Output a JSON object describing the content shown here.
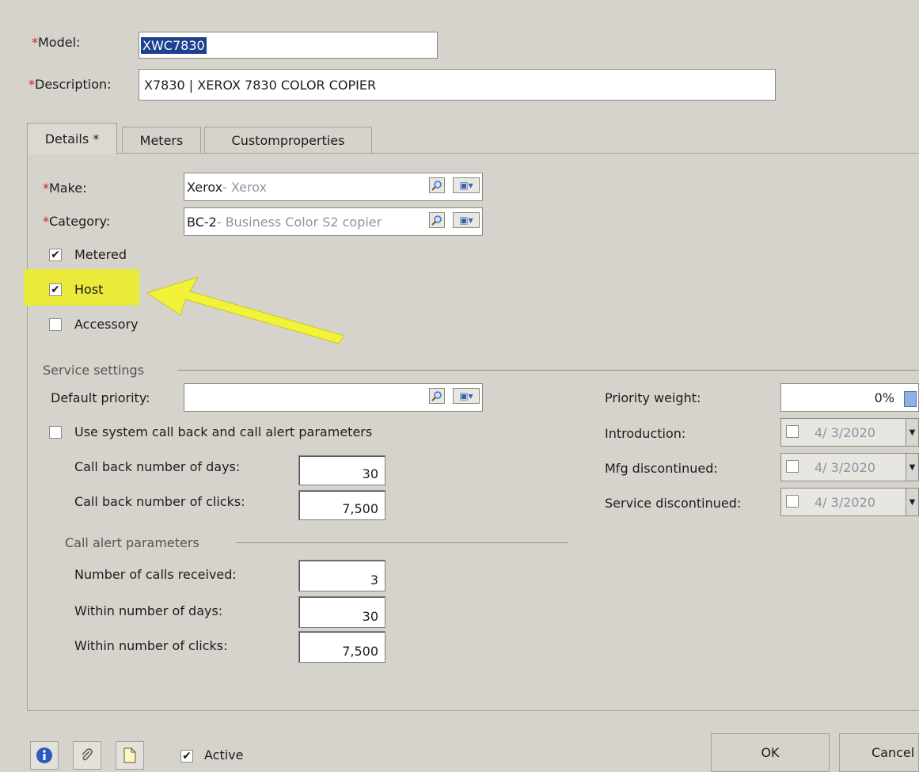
{
  "header": {
    "model_label": "Model:",
    "model_value": "XWC7830",
    "description_label": "Description:",
    "description_value": "X7830  |  XEROX 7830 COLOR COPIER"
  },
  "tabs": [
    {
      "label": "Details *"
    },
    {
      "label": "Meters"
    },
    {
      "label": "Customproperties"
    }
  ],
  "details": {
    "make_label": "Make:",
    "make_code": "Xerox",
    "make_desc": " - Xerox",
    "category_label": "Category:",
    "category_code": "BC-2",
    "category_desc": " - Business Color S2 copier",
    "metered_label": "Metered",
    "metered_checked": true,
    "host_label": "Host",
    "host_checked": true,
    "accessory_label": "Accessory",
    "accessory_checked": false
  },
  "service": {
    "group_title": "Service settings",
    "default_priority_label": "Default priority:",
    "default_priority_value": "",
    "use_system_label": "Use system call back and call alert parameters",
    "use_system_checked": false,
    "callback_days_label": "Call back number of days:",
    "callback_days_value": "30",
    "callback_clicks_label": "Call back number of clicks:",
    "callback_clicks_value": "7,500",
    "alert_group_title": "Call alert parameters",
    "calls_received_label": "Number of calls received:",
    "calls_received_value": "3",
    "within_days_label": "Within number of days:",
    "within_days_value": "30",
    "within_clicks_label": "Within number of clicks:",
    "within_clicks_value": "7,500",
    "priority_weight_label": "Priority weight:",
    "priority_weight_value": "0%",
    "introduction_label": "Introduction:",
    "introduction_value": "4/ 3/2020",
    "mfg_disc_label": "Mfg discontinued:",
    "mfg_disc_value": "4/ 3/2020",
    "service_disc_label": "Service discontinued:",
    "service_disc_value": "4/ 3/2020"
  },
  "footer": {
    "active_label": "Active",
    "active_checked": true,
    "ok_label": "OK",
    "cancel_label": "Cancel"
  },
  "colors": {
    "highlight": "#e9ea3a",
    "arrow": "#f2f23a",
    "required_marker": "#d21c1c",
    "selection": "#1f3f8f"
  },
  "icons": [
    "lookup-magnifier-icon",
    "dropdown-menu-icon",
    "info-icon",
    "paperclip-icon",
    "note-icon",
    "calculator-icon"
  ]
}
